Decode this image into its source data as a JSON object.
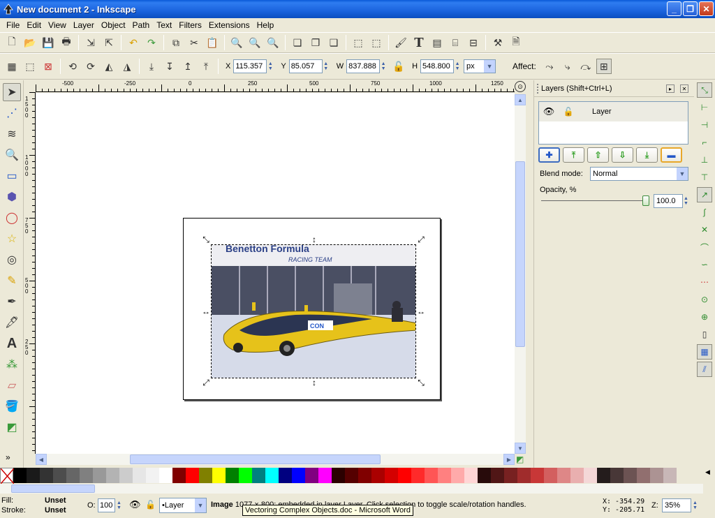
{
  "window": {
    "title": "New document 2 - Inkscape"
  },
  "menu": [
    "File",
    "Edit",
    "View",
    "Layer",
    "Object",
    "Path",
    "Text",
    "Filters",
    "Extensions",
    "Help"
  ],
  "toolcontrols": {
    "x_label": "X",
    "x_value": "115.357",
    "y_label": "Y",
    "y_value": "85.057",
    "w_label": "W",
    "w_value": "837.888",
    "h_label": "H",
    "h_value": "548.800",
    "unit": "px",
    "affect_label": "Affect:"
  },
  "ruler": {
    "h_labels": [
      "-500",
      "-250",
      "0",
      "250",
      "500",
      "750",
      "1000",
      "1250"
    ],
    "v_labels": [
      "1500",
      "1000",
      "750",
      "500",
      "250"
    ]
  },
  "layers_panel": {
    "title": "Layers (Shift+Ctrl+L)",
    "layer_name": "Layer",
    "blend_label": "Blend mode:",
    "blend_value": "Normal",
    "opacity_label": "Opacity, %",
    "opacity_value": "100.0",
    "opacity_level": 1.0
  },
  "palette": [
    "#000000",
    "#1a1a1a",
    "#333333",
    "#4d4d4d",
    "#666666",
    "#808080",
    "#999999",
    "#b3b3b3",
    "#cccccc",
    "#e6e6e6",
    "#f2f2f2",
    "#ffffff",
    "#800000",
    "#ff0000",
    "#808000",
    "#ffff00",
    "#008000",
    "#00ff00",
    "#008080",
    "#00ffff",
    "#000080",
    "#0000ff",
    "#800080",
    "#ff00ff",
    "#2b0000",
    "#550000",
    "#800000",
    "#aa0000",
    "#d40000",
    "#ff0000",
    "#ff2a2a",
    "#ff5555",
    "#ff8080",
    "#ffaaaa",
    "#ffd5d5",
    "#280b0b",
    "#501616",
    "#782121",
    "#a02c2c",
    "#c83737",
    "#d35f5f",
    "#de8787",
    "#e9afaf",
    "#f4d7d7",
    "#241c1c",
    "#483737",
    "#6c5353",
    "#916f6f",
    "#ac9393",
    "#c8b7b7"
  ],
  "status": {
    "fill_label": "Fill:",
    "fill_value": "Unset",
    "stroke_label": "Stroke:",
    "stroke_value": "Unset",
    "o_label": "O:",
    "o_value": "100",
    "layer_select": "•Layer",
    "msg_bold": "Image",
    "msg_rest": " 1077 × 800: embedded in layer Layer. Click selection to toggle scale/rotation handles.",
    "x_coord": "X: -354.29",
    "y_coord": "Y: -205.71",
    "z_label": "Z:",
    "zoom": "35%"
  },
  "tooltip": "Vectoring Complex Objects.doc - Microsoft Word"
}
